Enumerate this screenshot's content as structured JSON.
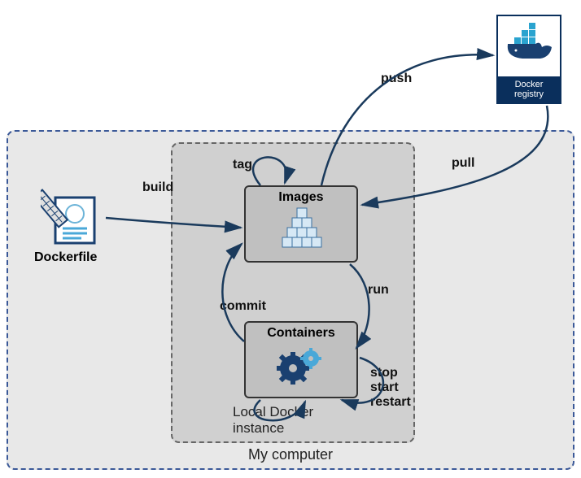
{
  "container": {
    "label": "My computer"
  },
  "localDocker": {
    "label": "Local Docker instance"
  },
  "images": {
    "title": "Images"
  },
  "containers": {
    "title": "Containers"
  },
  "dockerfile": {
    "label": "Dockerfile"
  },
  "registry": {
    "line1": "Docker",
    "line2": "registry"
  },
  "arrows": {
    "build": "build",
    "tag": "tag",
    "push": "push",
    "pull": "pull",
    "run": "run",
    "commit": "commit",
    "stop": "stop",
    "start": "start",
    "restart": "restart"
  }
}
